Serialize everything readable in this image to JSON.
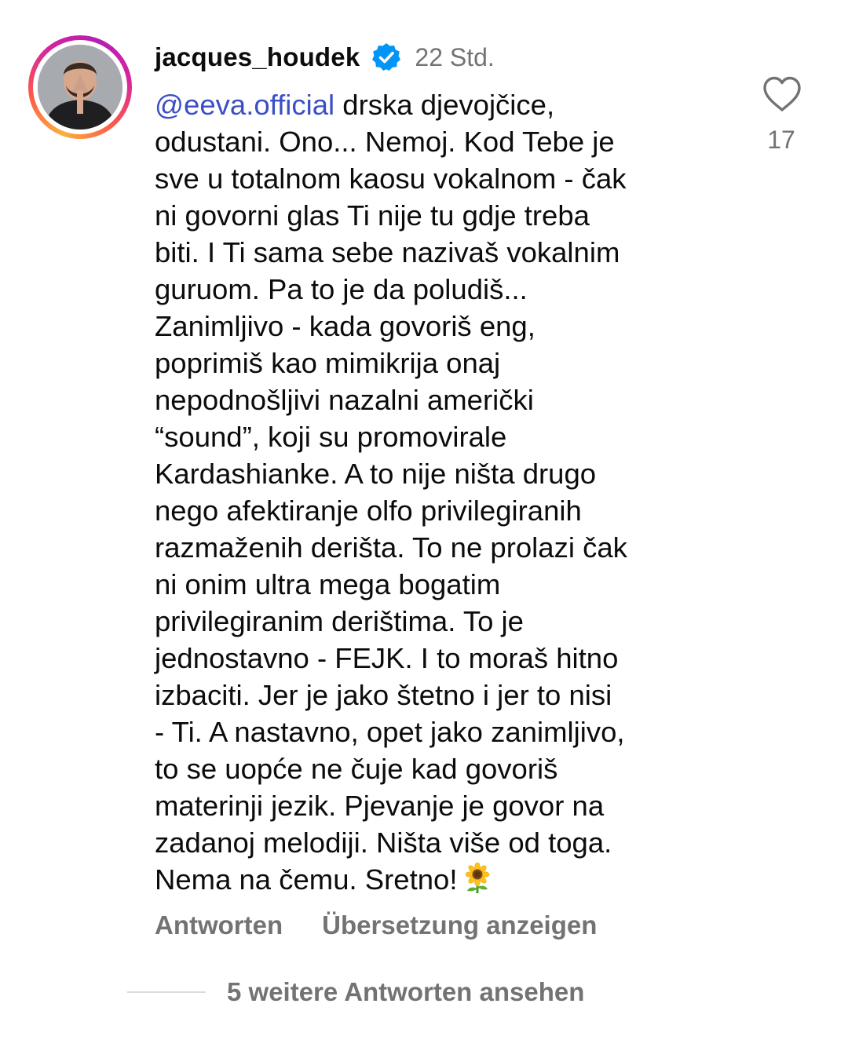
{
  "comment": {
    "username": "jacques_houdek",
    "verified": true,
    "timestamp": "22 Std.",
    "mention": "@eeva.official",
    "lines": [
      " drska djevojčice,",
      "odustani. Ono... Nemoj. Kod Tebe je",
      "sve u totalnom kaosu vokalnom - čak",
      "ni govorni glas Ti nije tu gdje treba",
      "biti. I Ti sama sebe nazivaš vokalnim",
      "guruom. Pa to je da poludiš...",
      "Zanimljivo - kada govoriš eng,",
      "poprimiš kao mimikrija onaj",
      "nepodnošljivi nazalni američki",
      "“sound”, koji su promovirale",
      "Kardashianke. A to nije ništa drugo",
      "nego afektiranje olfo privilegiranih",
      "razmaženih derišta. To ne prolazi čak",
      "ni onim ultra mega bogatim",
      "privilegiranim derištima. To je",
      "jednostavno - FEJK. I to moraš hitno",
      "izbaciti. Jer je jako štetno i jer to nisi",
      "- Ti. A nastavno, opet jako zanimljivo,",
      "to se uopće ne čuje kad govoriš",
      "materinji jezik. Pjevanje je govor na",
      "zadanoj melodiji. Ništa više od toga.",
      "Nema na čemu. Sretno!"
    ],
    "end_emoji": "sunflower",
    "like_count": "17",
    "reply_label": "Antworten",
    "translate_label": "Übersetzung anzeigen",
    "more_replies_label": "5 weitere Antworten ansehen"
  },
  "icons": {
    "avatar": "profile-photo",
    "badge": "verified-badge-icon",
    "like": "heart-outline-icon",
    "emoji": "sunflower-icon"
  },
  "colors": {
    "mention": "#3b4fc4",
    "secondary_text": "#737373",
    "verified_blue": "#0095f6"
  }
}
